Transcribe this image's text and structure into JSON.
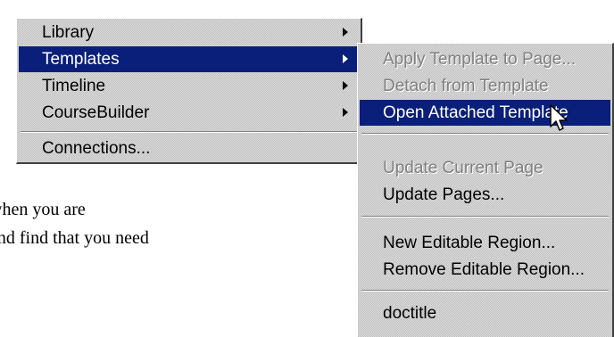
{
  "main_menu": {
    "items": [
      {
        "label": "Library"
      },
      {
        "label": "Templates"
      },
      {
        "label": "Timeline"
      },
      {
        "label": "CourseBuilder"
      },
      {
        "label": "Connections..."
      }
    ]
  },
  "templates_submenu": {
    "items": [
      {
        "label": "Apply Template to Page..."
      },
      {
        "label": "Detach from Template"
      },
      {
        "label": "Open Attached Template"
      },
      {
        "label": "Update Current Page"
      },
      {
        "label": "Update Pages..."
      },
      {
        "label": "New Editable Region..."
      },
      {
        "label": "Remove Editable Region..."
      },
      {
        "label": "doctitle"
      }
    ]
  },
  "document": {
    "line1": "when you are",
    "line2": "and find that you need"
  },
  "colors": {
    "menu_bg": "#c0c0c0",
    "highlight": "#0a1f7a",
    "disabled_text": "#808080"
  }
}
